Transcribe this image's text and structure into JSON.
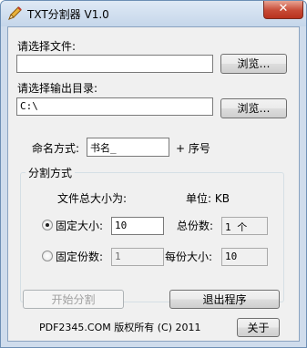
{
  "window": {
    "title": "TXT分割器  V1.0",
    "close_glyph": "✕",
    "icon": "pencil-icon"
  },
  "source": {
    "label": "请选择文件:",
    "value": "",
    "browse_label": "浏览…"
  },
  "output": {
    "label": "请选择输出目录:",
    "value": "C:\\",
    "browse_label": "浏览…"
  },
  "naming": {
    "label": "命名方式:",
    "value": "书名_",
    "suffix": "+ 序号"
  },
  "split": {
    "group_label": "分割方式",
    "total_size_label": "文件总大小为:",
    "unit_label": "单位: KB",
    "mode_size": {
      "label": "固定大小:",
      "value": "10",
      "checked": true
    },
    "total_parts": {
      "label": "总份数:",
      "value": "1 个"
    },
    "mode_parts": {
      "label": "固定份数:",
      "value": "1",
      "checked": false
    },
    "part_size": {
      "label": "每份大小:",
      "value": "10"
    }
  },
  "actions": {
    "start_label": "开始分割",
    "exit_label": "退出程序",
    "about_label": "关于"
  },
  "footer": {
    "copyright": "PDF2345.COM 版权所有 (C) 2011"
  }
}
